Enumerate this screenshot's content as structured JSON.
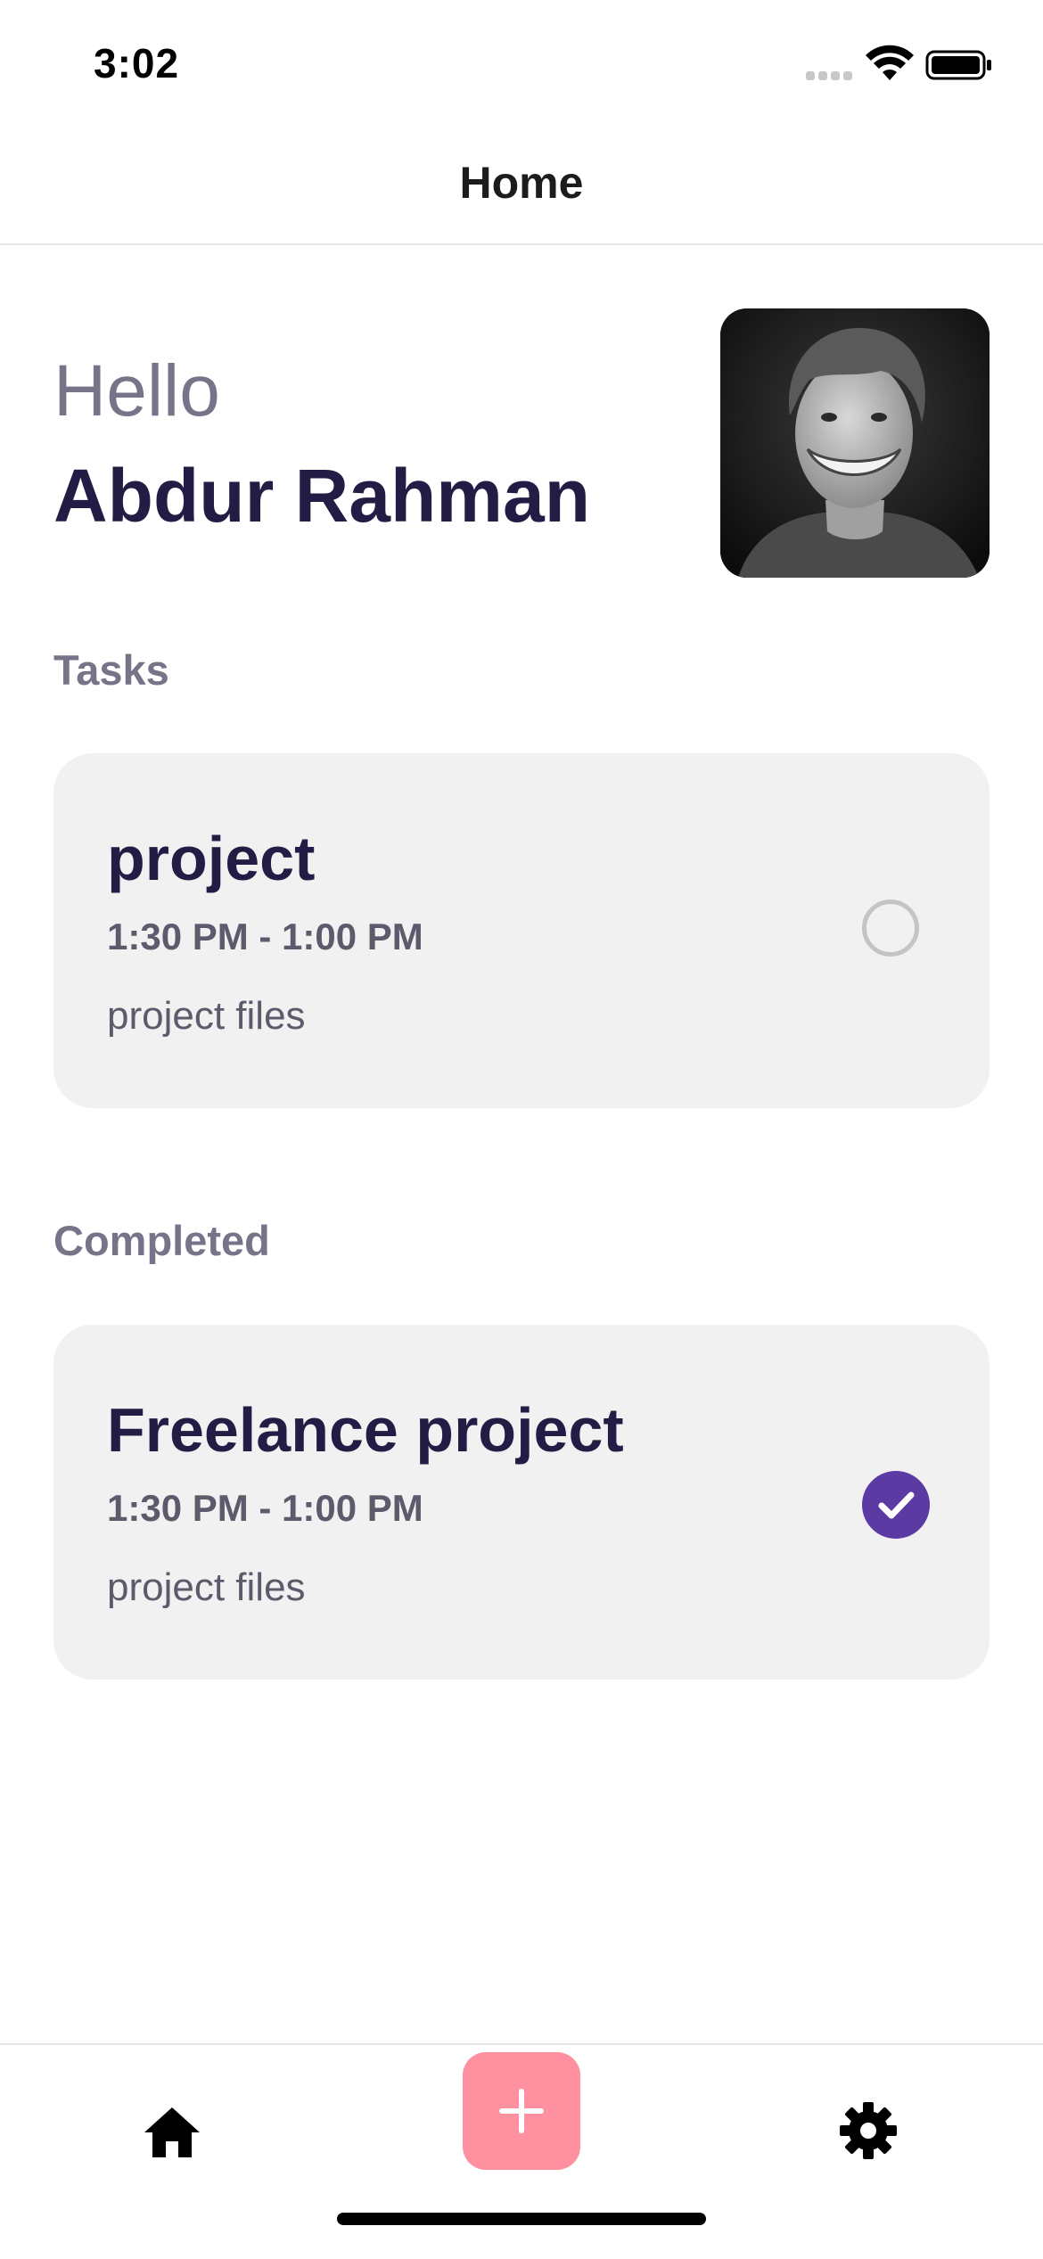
{
  "status_bar": {
    "time": "3:02"
  },
  "header": {
    "title": "Home"
  },
  "greeting": {
    "hello": "Hello",
    "name": "Abdur Rahman"
  },
  "sections": {
    "tasks_label": "Tasks",
    "completed_label": "Completed"
  },
  "tasks": [
    {
      "title": "project",
      "time": "1:30 PM - 1:00 PM",
      "description": "project files",
      "completed": false
    }
  ],
  "completed": [
    {
      "title": "Freelance project",
      "time": "1:30 PM - 1:00 PM",
      "description": "project files",
      "completed": true
    }
  ],
  "tab_bar": {
    "items": [
      "home-icon",
      "plus-icon",
      "gear-icon"
    ]
  },
  "colors": {
    "accent_purple": "#5c3aa4",
    "add_button_pink": "#fe909f",
    "card_background": "#f1f1f2",
    "heading_text": "#231c45",
    "muted_text": "#777489"
  }
}
